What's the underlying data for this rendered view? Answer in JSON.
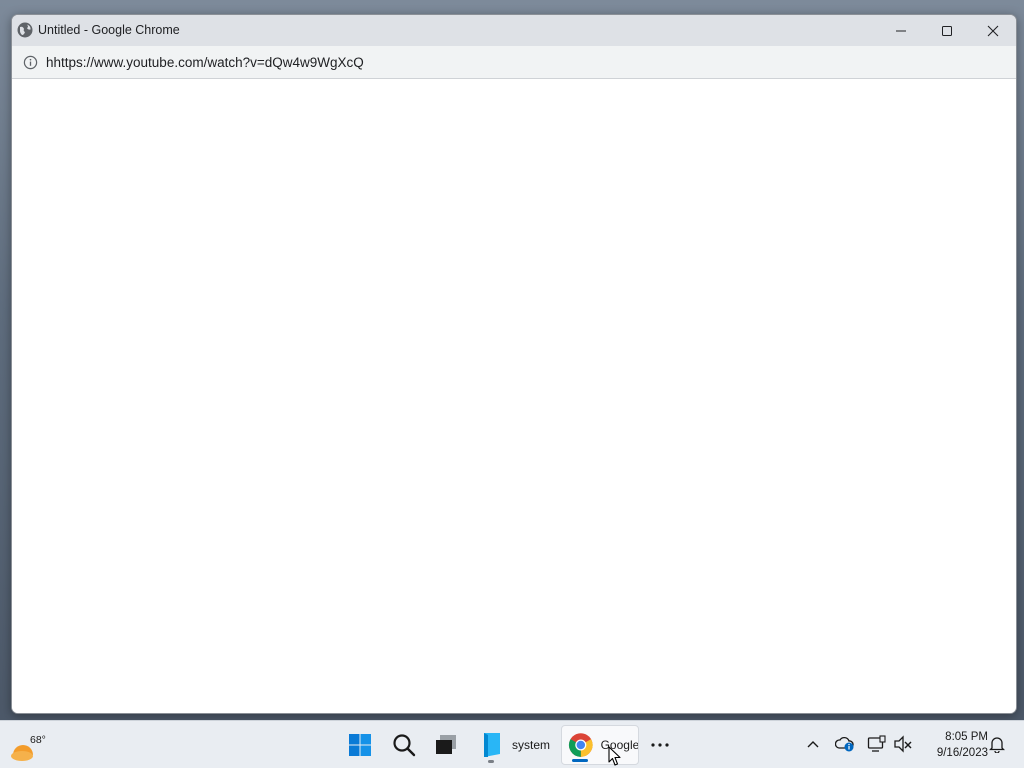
{
  "window": {
    "title": "Untitled - Google Chrome",
    "url": "hhttps://www.youtube.com/watch?v=dQw4w9WgXcQ"
  },
  "taskbar": {
    "weather_temp": "68°",
    "apps": [
      {
        "label": "system",
        "icon": "file-explorer-icon"
      },
      {
        "label": "Google",
        "icon": "chrome-icon"
      }
    ],
    "clock_time": "8:05 PM",
    "clock_date": "9/16/2023"
  },
  "colors": {
    "titlebar": "#dee1e6",
    "addressbar": "#f1f3f4",
    "taskbar": "#e9edf2",
    "accent": "#0067c0"
  }
}
